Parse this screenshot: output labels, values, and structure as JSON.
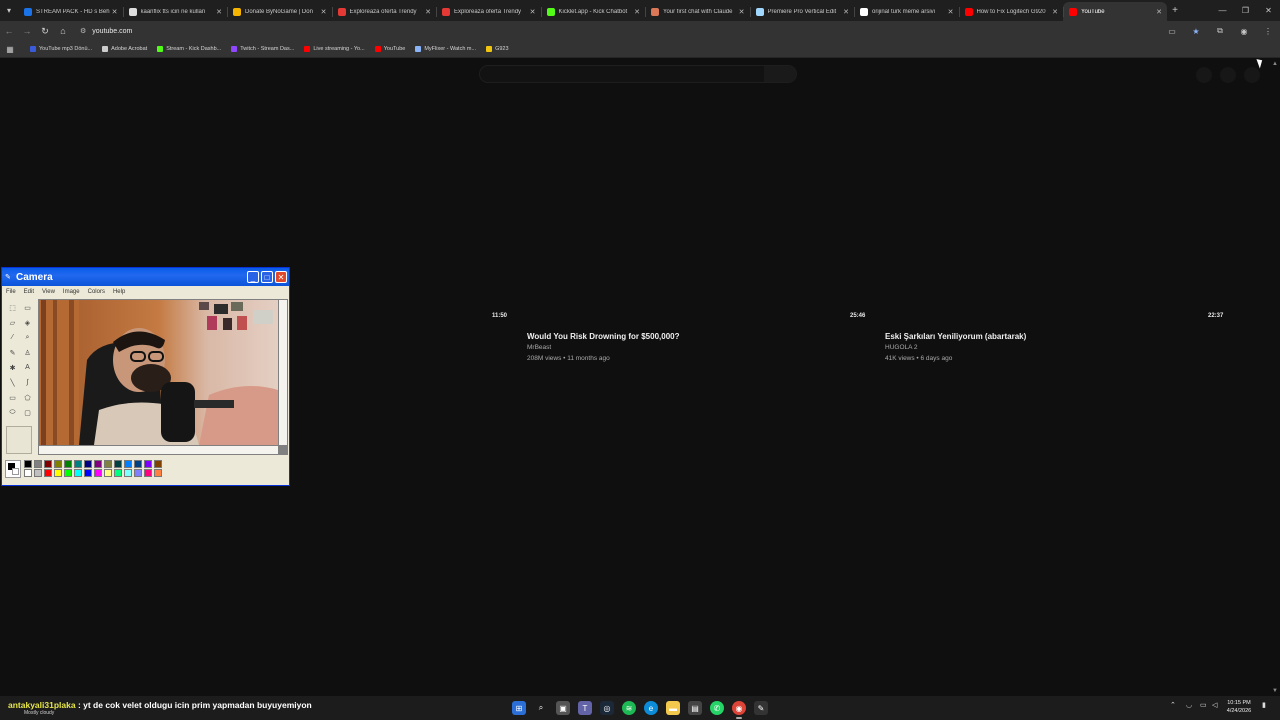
{
  "browser": {
    "tabs": [
      {
        "title": "STREAM PACK - HD s Beh",
        "favicon_color": "#1a73e8",
        "active": false
      },
      {
        "title": "kaanflix tts icin ne kullan",
        "favicon_color": "#dddddd",
        "active": false
      },
      {
        "title": "Donate ByNoGame | Don",
        "favicon_color": "#f4b400",
        "active": false
      },
      {
        "title": "Explorează oferta Trendy",
        "favicon_color": "#e53935",
        "active": false
      },
      {
        "title": "Explorează oferta Trendy",
        "favicon_color": "#e53935",
        "active": false
      },
      {
        "title": "Kicklet.app - Kick Chatbot",
        "favicon_color": "#53fc18",
        "active": false
      },
      {
        "title": "Your first chat with Claude",
        "favicon_color": "#d97757",
        "active": false
      },
      {
        "title": "Premiere Pro Vertical Edit",
        "favicon_color": "#9fd7ff",
        "active": false
      },
      {
        "title": "orijinal turk meme arsivi",
        "favicon_color": "#ffffff",
        "active": false
      },
      {
        "title": "How to Fix Logitech G920",
        "favicon_color": "#ff0000",
        "active": false
      },
      {
        "title": "YouTube",
        "favicon_color": "#ff0000",
        "active": true
      }
    ],
    "tab_close_glyph": "✕",
    "new_tab_glyph": "+",
    "url": "youtube.com",
    "bookmarks": [
      {
        "label": "YouTube mp3 Dönü...",
        "icon_color": "#3b5bdb"
      },
      {
        "label": "Adobe Acrobat",
        "icon_color": "#cccccc"
      },
      {
        "label": "Stream - Kick Dashb...",
        "icon_color": "#53fc18"
      },
      {
        "label": "Twitch - Stream Das...",
        "icon_color": "#9146ff"
      },
      {
        "label": "Live streaming - Yo...",
        "icon_color": "#ff0000"
      },
      {
        "label": "YouTube",
        "icon_color": "#ff0000"
      },
      {
        "label": "MyFlixer - Watch m...",
        "icon_color": "#8ab4f8"
      },
      {
        "label": "G923",
        "icon_color": "#f1c40f"
      }
    ]
  },
  "youtube": {
    "durations": [
      "11:50",
      "25:46",
      "22:37"
    ],
    "videos": [
      {
        "title": "Would You Risk Drowning for $500,000?",
        "channel": "MrBeast",
        "meta": "208M views • 11 months ago"
      },
      {
        "title": "Eski Şarkıları Yeniliyorum (abartarak)",
        "channel": "HUGOLA 2",
        "meta": "41K views • 6 days ago"
      }
    ]
  },
  "camera_window": {
    "title": "Camera",
    "menu": [
      "File",
      "Edit",
      "View",
      "Image",
      "Colors",
      "Help"
    ],
    "palette": [
      "#000000",
      "#808080",
      "#800000",
      "#808000",
      "#008000",
      "#008080",
      "#000080",
      "#800080",
      "#808040",
      "#004040",
      "#0080ff",
      "#004080",
      "#8000ff",
      "#804000",
      "#ffffff",
      "#c0c0c0",
      "#ff0000",
      "#ffff00",
      "#00ff00",
      "#00ffff",
      "#0000ff",
      "#ff00ff",
      "#ffff80",
      "#00ff80",
      "#80ffff",
      "#8080ff",
      "#ff0080",
      "#ff8040"
    ]
  },
  "taskbar": {
    "chat_user": "antakyali31plaka",
    "chat_message": " : yt de cok velet oldugu icin prim yapmadan buyuyemiyon",
    "weather": "Mostly cloudy",
    "time": "10:15 PM",
    "date": "4/24/2026"
  }
}
